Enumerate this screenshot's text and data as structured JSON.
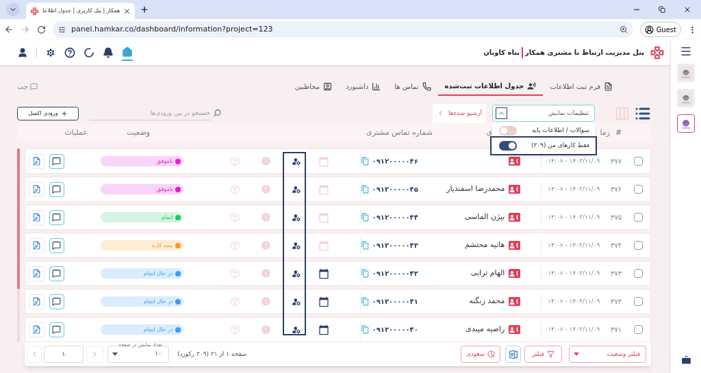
{
  "browser": {
    "tab_title": "همکار | پنل کاربری | جدول اطلاعا",
    "url": "panel.hamkar.co/dashboard/information?project=123",
    "profile": "Guest"
  },
  "header": {
    "title": "پنل مدیریت ارتباط با مشتری همکار",
    "subtitle": "پناه کاویان",
    "nav": [
      {
        "kind": "home",
        "selected": true
      },
      {
        "kind": "bell",
        "selected": false
      },
      {
        "kind": "loader",
        "selected": false
      },
      {
        "kind": "help",
        "selected": false
      },
      {
        "kind": "settings",
        "selected": false
      },
      {
        "kind": "user",
        "selected": false
      }
    ]
  },
  "sidebar": {
    "thumbnails": [
      {
        "kind": "picture",
        "selected": false
      },
      {
        "kind": "picture",
        "selected": false
      },
      {
        "kind": "picture",
        "selected": true
      }
    ]
  },
  "tabs": [
    {
      "label": "فرم ثبت اطلاعات",
      "kind": "form",
      "selected": false
    },
    {
      "label": "جدول اطلاعات ثبت‌شده",
      "kind": "table",
      "selected": true
    },
    {
      "label": "تماس ها",
      "kind": "calls",
      "selected": false
    },
    {
      "label": "داشبورد",
      "kind": "dashboard",
      "selected": false
    },
    {
      "label": "مخاطبین",
      "kind": "contacts",
      "selected": false
    }
  ],
  "chat_link": "چت",
  "toolbar": {
    "views": [
      {
        "kind": "list",
        "selected": true
      },
      {
        "kind": "columns",
        "selected": false
      }
    ],
    "display_settings": {
      "value": "تنظیمات نمایش",
      "expanded": true
    },
    "archived_button": "آرشیو شده‌ها",
    "search": {
      "placeholder": "جستجو در بین ورودی‌ها"
    },
    "excel_button": "ورودی اکسل"
  },
  "settings_menu": [
    {
      "label": "سوالات / اطلاعات پایه",
      "on": false
    },
    {
      "label": "فقط کارهای من (۳۰۹)",
      "on": true
    }
  ],
  "table": {
    "columns": [
      {
        "label": "#",
        "kind": "number"
      },
      {
        "label": "زما",
        "kind": "time"
      },
      {
        "label": "ی",
        "kind": "name"
      },
      {
        "label": "شماره تماس مشتری",
        "kind": "phone"
      },
      {
        "label": "وضعیت",
        "kind": "status"
      },
      {
        "label": "عملیات",
        "kind": "actions"
      }
    ],
    "rows": [
      {
        "number": "۳۷۷",
        "time": "۱۴۰۳/۱۱/۰۹ - ۱۴:۰۶",
        "phone": "۰۹۱۲۰۰۰۰۰۴۶",
        "checked": false,
        "scheduled": false,
        "flagged": true,
        "status": {
          "label": "ناموفق",
          "color": "#e619d8"
        }
      },
      {
        "number": "۳۷۶",
        "time": "۱۴۰۳/۱۱/۰۹ - ۱۴:۰۶",
        "name": "محمدرضا اسفندیار",
        "phone": "۰۹۱۲۰۰۰۰۰۴۵",
        "checked": false,
        "scheduled": false,
        "flagged": true,
        "status": {
          "label": "ناموفق",
          "color": "#e619d8"
        }
      },
      {
        "number": "۳۷۵",
        "time": "۱۴۰۳/۱۱/۰۹ - ۱۴:۰۶",
        "name": "بیژن الماسی",
        "phone": "۰۹۱۲۰۰۰۰۰۴۴",
        "checked": false,
        "scheduled": false,
        "flagged": true,
        "status": {
          "label": "اتمام",
          "color": "#22c55e"
        }
      },
      {
        "number": "۳۷۴",
        "time": "۱۴۰۳/۱۱/۰۹ - ۱۴:۰۶",
        "name": "هانیه محتشم",
        "phone": "۰۹۱۲۰۰۰۰۰۴۳",
        "checked": false,
        "scheduled": false,
        "flagged": true,
        "status": {
          "label": "نیمه کاره",
          "color": "#fb9a1e"
        }
      },
      {
        "number": "۳۷۳",
        "time": "۱۴۰۳/۱۱/۰۹ - ۱۴:۰۶",
        "name": "الهام ترابی",
        "phone": "۰۹۱۲۰۰۰۰۰۴۲",
        "checked": false,
        "scheduled": true,
        "flagged": true,
        "status": {
          "label": "در حال انجام",
          "color": "#3b9cf5"
        }
      },
      {
        "number": "۳۷۲",
        "time": "۱۴۰۳/۱۱/۰۹ - ۱۴:۰۶",
        "name": "محمد زنگنه",
        "phone": "۰۹۱۲۰۰۰۰۰۴۱",
        "checked": false,
        "scheduled": true,
        "flagged": false,
        "status": {
          "label": "در حال انجام",
          "color": "#3b9cf5"
        }
      },
      {
        "number": "۳۷۱",
        "time": "۱۴۰۳/۱۱/۰۹ - ۱۴:۰۶",
        "name": "راضیه میبدی",
        "phone": "۰۹۱۲۰۰۰۰۰۴۰",
        "checked": false,
        "scheduled": true,
        "flagged": false,
        "status": {
          "label": "در حال انجام",
          "color": "#3b9cf5"
        }
      }
    ]
  },
  "footer": {
    "status_filter": "فیلتر وضعیت",
    "filter_button": "فیلتر",
    "sort_button": "صعودی",
    "page_info": "صفحه ۱ از ۳۱ (۳۰۹ رکورد)",
    "page_size": {
      "label": "تعداد نمایش در صفحه",
      "value": "۱۰"
    },
    "page": "۱"
  }
}
